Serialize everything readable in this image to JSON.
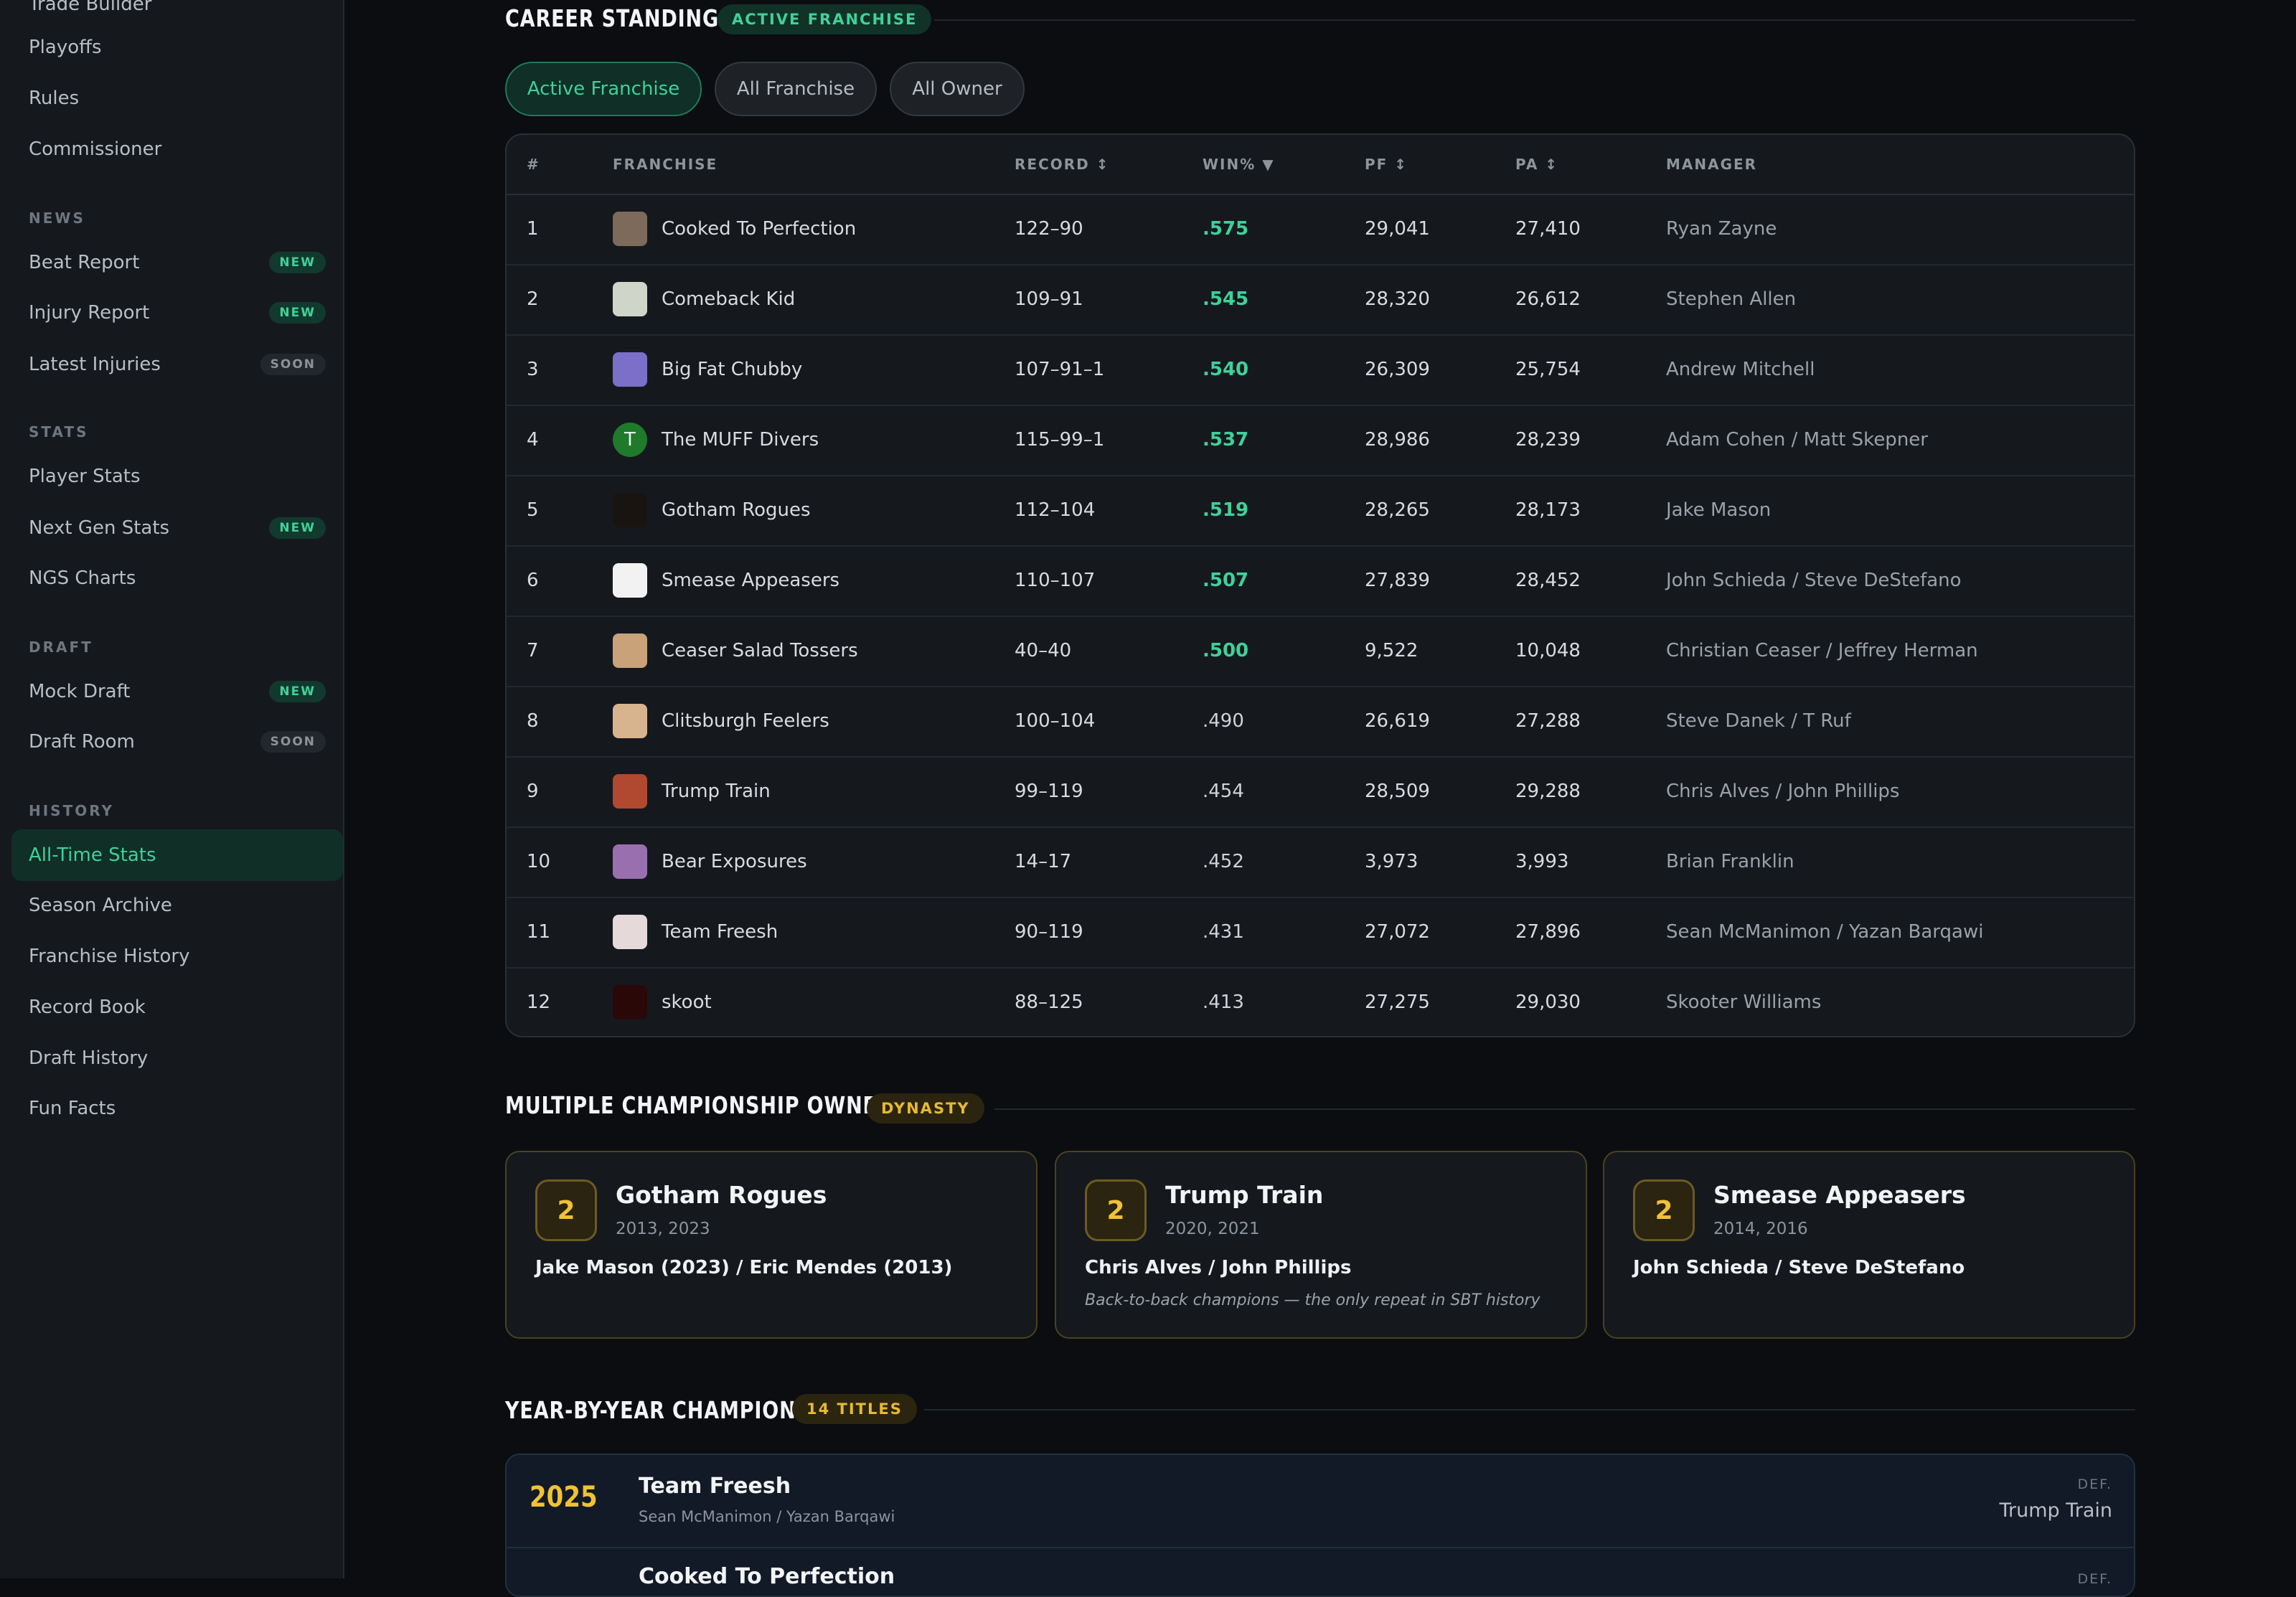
{
  "sidebar": {
    "top_partial": "Trade Builder",
    "items_top": [
      "Playoffs",
      "Rules",
      "Commissioner"
    ],
    "sections": [
      {
        "heading": "NEWS",
        "items": [
          {
            "label": "Beat Report",
            "badge": "NEW"
          },
          {
            "label": "Injury Report",
            "badge": "NEW"
          },
          {
            "label": "Latest Injuries",
            "badge": "SOON"
          }
        ]
      },
      {
        "heading": "STATS",
        "items": [
          {
            "label": "Player Stats",
            "badge": ""
          },
          {
            "label": "Next Gen Stats",
            "badge": "NEW"
          },
          {
            "label": "NGS Charts",
            "badge": ""
          }
        ]
      },
      {
        "heading": "DRAFT",
        "items": [
          {
            "label": "Mock Draft",
            "badge": "NEW"
          },
          {
            "label": "Draft Room",
            "badge": "SOON"
          }
        ]
      },
      {
        "heading": "HISTORY",
        "items": [
          {
            "label": "All-Time Stats",
            "badge": "",
            "active": true
          },
          {
            "label": "Season Archive",
            "badge": ""
          },
          {
            "label": "Franchise History",
            "badge": ""
          },
          {
            "label": "Record Book",
            "badge": ""
          },
          {
            "label": "Draft History",
            "badge": ""
          },
          {
            "label": "Fun Facts",
            "badge": ""
          }
        ]
      }
    ]
  },
  "standings": {
    "title": "CAREER STANDINGS",
    "pill": "ACTIVE FRANCHISE",
    "filters": [
      "Active Franchise",
      "All Franchise",
      "All Owner"
    ],
    "active_filter": "Active Franchise",
    "columns": {
      "rank": "#",
      "franchise": "FRANCHISE",
      "record": "RECORD ↕",
      "win": "WIN% ▼",
      "pf": "PF ↕",
      "pa": "PA ↕",
      "manager": "MANAGER"
    },
    "rows": [
      {
        "rank": "1",
        "franchise": "Cooked To Perfection",
        "record": "122–90",
        "win": ".575",
        "pf": "29,041",
        "pa": "27,410",
        "manager": "Ryan Zayne",
        "pos": true,
        "logo": "#7d6a5a"
      },
      {
        "rank": "2",
        "franchise": "Comeback Kid",
        "record": "109–91",
        "win": ".545",
        "pf": "28,320",
        "pa": "26,612",
        "manager": "Stephen Allen",
        "pos": true,
        "logo": "#cfd6c9"
      },
      {
        "rank": "3",
        "franchise": "Big Fat Chubby",
        "record": "107–91–1",
        "win": ".540",
        "pf": "26,309",
        "pa": "25,754",
        "manager": "Andrew Mitchell",
        "pos": true,
        "logo": "#7b6fc9"
      },
      {
        "rank": "4",
        "franchise": "The MUFF Divers",
        "record": "115–99–1",
        "win": ".537",
        "pf": "28,986",
        "pa": "28,239",
        "manager": "Adam Cohen / Matt Skepner",
        "pos": true,
        "logo": "#1f7a2c",
        "initial": "T"
      },
      {
        "rank": "5",
        "franchise": "Gotham Rogues",
        "record": "112–104",
        "win": ".519",
        "pf": "28,265",
        "pa": "28,173",
        "manager": "Jake Mason",
        "pos": true,
        "logo": "#1a1410"
      },
      {
        "rank": "6",
        "franchise": "Smease Appeasers",
        "record": "110–107",
        "win": ".507",
        "pf": "27,839",
        "pa": "28,452",
        "manager": "John Schieda / Steve DeStefano",
        "pos": true,
        "logo": "#f2f2f2"
      },
      {
        "rank": "7",
        "franchise": "Ceaser Salad Tossers",
        "record": "40–40",
        "win": ".500",
        "pf": "9,522",
        "pa": "10,048",
        "manager": "Christian Ceaser / Jeffrey Herman",
        "pos": true,
        "logo": "#c9a27a"
      },
      {
        "rank": "8",
        "franchise": "Clitsburgh Feelers",
        "record": "100–104",
        "win": ".490",
        "pf": "26,619",
        "pa": "27,288",
        "manager": "Steve Danek / T Ruf",
        "pos": false,
        "logo": "#d8b48e"
      },
      {
        "rank": "9",
        "franchise": "Trump Train",
        "record": "99–119",
        "win": ".454",
        "pf": "28,509",
        "pa": "29,288",
        "manager": "Chris Alves / John Phillips",
        "pos": false,
        "logo": "#b0492f"
      },
      {
        "rank": "10",
        "franchise": "Bear Exposures",
        "record": "14–17",
        "win": ".452",
        "pf": "3,973",
        "pa": "3,993",
        "manager": "Brian Franklin",
        "pos": false,
        "logo": "#9a6fb0"
      },
      {
        "rank": "11",
        "franchise": "Team Freesh",
        "record": "90–119",
        "win": ".431",
        "pf": "27,072",
        "pa": "27,896",
        "manager": "Sean McManimon / Yazan Barqawi",
        "pos": false,
        "logo": "#e6d9d9"
      },
      {
        "rank": "12",
        "franchise": "skoot",
        "record": "88–125",
        "win": ".413",
        "pf": "27,275",
        "pa": "29,030",
        "manager": "Skooter Williams",
        "pos": false,
        "logo": "#2a0808"
      }
    ]
  },
  "multi": {
    "title": "MULTIPLE CHAMPIONSHIP OWNERS",
    "pill": "DYNASTY",
    "cards": [
      {
        "count": "2",
        "team": "Gotham Rogues",
        "years": "2013, 2023",
        "owner": "Jake Mason (2023) / Eric Mendes (2013)",
        "note": ""
      },
      {
        "count": "2",
        "team": "Trump Train",
        "years": "2020, 2021",
        "owner": "Chris Alves / John Phillips",
        "note": "Back-to-back champions — the only repeat in SBT history"
      },
      {
        "count": "2",
        "team": "Smease Appeasers",
        "years": "2014, 2016",
        "owner": "John Schieda / Steve DeStefano",
        "note": ""
      }
    ]
  },
  "year_champs": {
    "title": "YEAR-BY-YEAR CHAMPIONS",
    "pill": "14 TITLES",
    "rows": [
      {
        "year": "2025",
        "team": "Team Freesh",
        "owners": "Sean McManimon / Yazan Barqawi",
        "def_label": "DEF.",
        "defeated": "Trump Train"
      },
      {
        "year": "",
        "team": "Cooked To Perfection",
        "owners": "",
        "def_label": "DEF.",
        "defeated": ""
      }
    ]
  },
  "colors": {
    "accent": "#3fd19a",
    "gold": "#f1c232",
    "bg": "#0b0d10",
    "panel": "#15191e"
  }
}
